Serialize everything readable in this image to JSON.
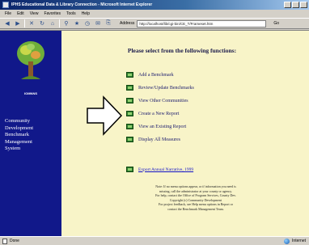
{
  "window": {
    "title": "IPHS Educational Data & Library Connection - Microsoft Internet Explorer"
  },
  "menu": [
    "File",
    "Edit",
    "View",
    "Favorites",
    "Tools",
    "Help"
  ],
  "toolbar": {
    "buttons": [
      "back-icon",
      "forward-icon",
      "stop-icon",
      "refresh-icon",
      "home-icon",
      "search-icon",
      "favorites-icon",
      "history-icon",
      "mail-icon",
      "print-icon"
    ],
    "address_label": "Address",
    "address_value": "http://localhost/lib/cgi-bin/CE_T/Frameset.htm",
    "go_label": "Go"
  },
  "sidebar": {
    "caption": "IOMNNS",
    "nav_lines": [
      "Community",
      "Development",
      "Benchmark",
      "Management",
      "System"
    ]
  },
  "content": {
    "heading": "Please select from the following functions:",
    "menu_items": [
      "Add a Benchmark",
      "Review/Update Benchmarks",
      "View Other Communities",
      "Create a New Report",
      "View an Existing Report",
      "Display All Measures"
    ],
    "report_link": "Export Annual Narrative, 1999",
    "footer_lines": [
      "Note: If no menu options appear, or if information you need is",
      "missing, call the administrator at your county or agency.",
      "For help, contact the Office of Program Services, County Dev.",
      "Copyright (c) Community Development",
      "For project feedback, see Help menu options in Report or",
      "contact the Benchmark Management Team."
    ]
  },
  "status": {
    "left": "Done",
    "right": "Internet"
  },
  "colors": {
    "sidebar": "#11188a",
    "page_bg": "#f8f4c8",
    "title_gradient_start": "#0a246a"
  }
}
